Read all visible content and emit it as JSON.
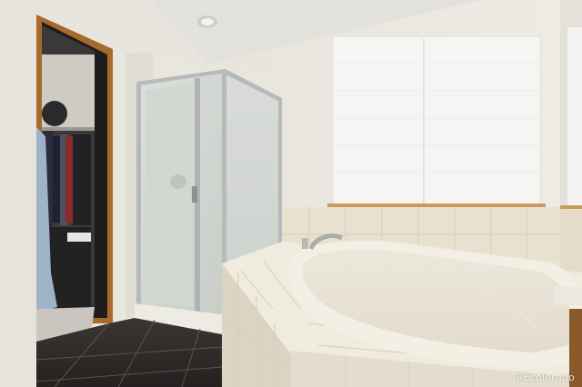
{
  "photo": {
    "subject": "bathroom",
    "watermark_text": "REcolorado"
  },
  "palette": {
    "wall": "#ebe7de",
    "ceiling": "#e2e0db",
    "window_shade": "#f4f4f2",
    "tile_cream": "#e9e1cf",
    "floor_tile": "#2f2c2a",
    "door_frame": "#a8692d",
    "glass": "#d7dbd6",
    "chrome": "#b7b9ba",
    "tub": "#f2ede2"
  }
}
